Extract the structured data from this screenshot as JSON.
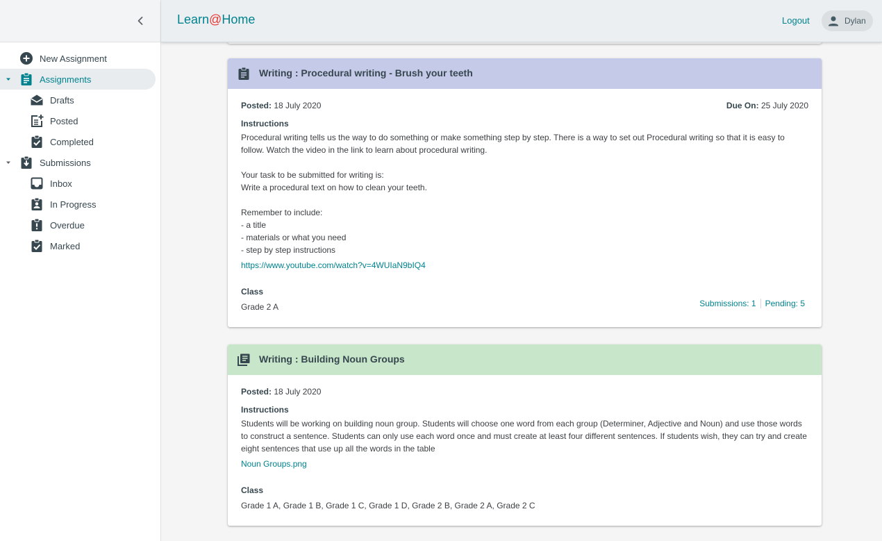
{
  "app": {
    "brand_prefix": "Learn",
    "brand_at": "@",
    "brand_suffix": "Home",
    "logout_label": "Logout",
    "user_name": "Dylan"
  },
  "sidebar": {
    "new_assignment": "New Assignment",
    "assignments": {
      "label": "Assignments",
      "items": [
        "Drafts",
        "Posted",
        "Completed"
      ]
    },
    "submissions": {
      "label": "Submissions",
      "items": [
        "Inbox",
        "In Progress",
        "Overdue",
        "Marked"
      ]
    }
  },
  "cards": [
    {
      "title": "Writing : Procedural writing - Brush your teeth",
      "header_color": "#c5cae9",
      "posted_label": "Posted:",
      "posted": "18 July 2020",
      "due_label": "Due On:",
      "due": "25 July 2020",
      "instructions_label": "Instructions",
      "instructions": "Procedural writing tells us the way to do something or make something step by step. There is a way to set out Procedural writing so that it is easy to follow. Watch the video in the link to learn about procedural writing.\n\nYour task to be submitted for writing is:\nWrite a procedural text on how to clean your teeth.\n\nRemember to include:\n- a title\n- materials or what you need\n- step by step instructions",
      "link": "https://www.youtube.com/watch?v=4WUIaN9bIQ4",
      "class_label": "Class",
      "class": "Grade 2 A",
      "submissions": "Submissions: 1",
      "pending": "Pending: 5"
    },
    {
      "title": "Writing : Building Noun Groups",
      "header_color": "#c8e6c9",
      "posted_label": "Posted:",
      "posted": "18 July 2020",
      "instructions_label": "Instructions",
      "instructions": "Students will be working on building noun group. Students will choose one word from each group (Determiner, Adjective and Noun) and use those words to construct a sentence. Students can only use each word once and must create at least four different sentences. If students wish, they can try and create eight sentences that use up all the words in the table",
      "link": "Noun Groups.png",
      "class_label": "Class",
      "class": "Grade 1 A, Grade 1 B, Grade 1 C, Grade 1 D, Grade 2 B, Grade 2 A, Grade 2 C"
    }
  ],
  "colors": {
    "accent": "#00838f",
    "brand_at": "#e53935",
    "icon": "#37474f"
  }
}
